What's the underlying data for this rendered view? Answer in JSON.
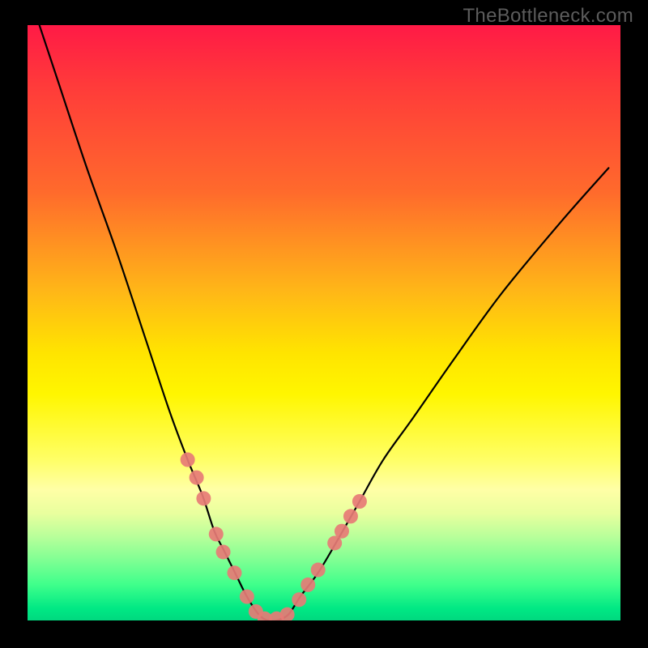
{
  "watermark": "TheBottleneck.com",
  "colors": {
    "background": "#000000",
    "curve": "#000000",
    "marker_fill": "#e77b76",
    "gradient_top": "#ff1a46",
    "gradient_bottom": "#00d97f"
  },
  "chart_data": {
    "type": "line",
    "title": "",
    "xlabel": "",
    "ylabel": "",
    "xlim": [
      0,
      100
    ],
    "ylim": [
      0,
      100
    ],
    "curve": {
      "name": "bottleneck-curve",
      "x": [
        2,
        5,
        10,
        15,
        20,
        24,
        27,
        29.5,
        31.5,
        33,
        35,
        37,
        39,
        40.5,
        42,
        44,
        46,
        49,
        52,
        56,
        60,
        65,
        72,
        80,
        90,
        98
      ],
      "y": [
        100,
        91,
        76,
        62,
        47,
        35,
        27,
        21,
        15,
        12,
        8,
        4,
        1,
        0,
        0,
        1,
        4,
        8,
        13,
        20,
        27,
        34,
        44,
        55,
        67,
        76
      ]
    },
    "markers": {
      "name": "highlight-points",
      "x": [
        27.0,
        28.5,
        29.7,
        31.8,
        33.0,
        34.9,
        37.0,
        38.5,
        40.0,
        42.0,
        43.8,
        45.8,
        47.3,
        49.0,
        51.8,
        53.0,
        54.5,
        56.0
      ],
      "y": [
        27.0,
        24.0,
        20.5,
        14.5,
        11.5,
        8.0,
        4.0,
        1.5,
        0.3,
        0.3,
        1.0,
        3.5,
        6.0,
        8.5,
        13.0,
        15.0,
        17.5,
        20.0
      ]
    }
  }
}
